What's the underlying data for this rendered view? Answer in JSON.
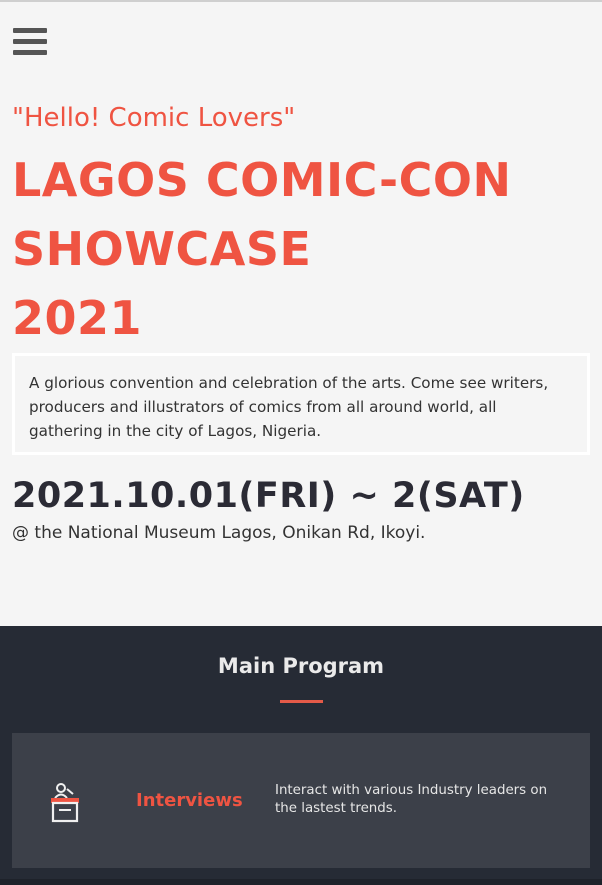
{
  "header": {
    "menu_icon": "hamburger-menu-icon"
  },
  "hero": {
    "tagline": "\"Hello! Comic Lovers\"",
    "title_lines": [
      "Lagos Comic-Con",
      "Showcase",
      "2021"
    ],
    "description": "A glorious convention and celebration of the arts. Come see writers, producers and illustrators of comics from all around world, all gathering in the city of Lagos, Nigeria.",
    "date": "2021.10.01(FRI) ~ 2(SAT)",
    "venue": "@ the National Museum Lagos, Onikan Rd, Ikoyi."
  },
  "program": {
    "heading": "Main Program",
    "items": [
      {
        "icon": "podium-icon",
        "title": "Interviews",
        "text": "Interact with various Industry leaders on the lastest trends."
      }
    ]
  },
  "colors": {
    "accent": "#ef5442",
    "dark_bg": "#262b35",
    "card_bg": "#3c4049",
    "page_bg": "#f5f5f5"
  }
}
